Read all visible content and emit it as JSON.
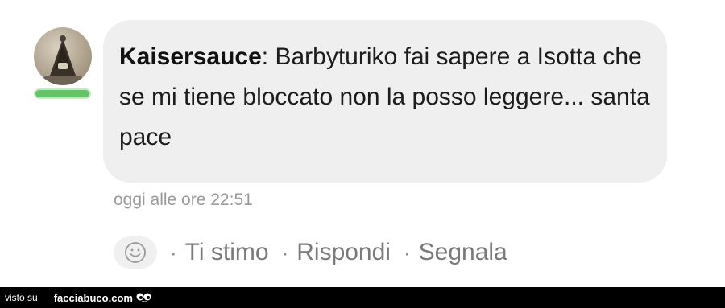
{
  "comment": {
    "author": "Kaisersauce",
    "separator": ":",
    "text": " Barbyturiko fai sapere a Isotta che se mi tiene bloccato non la posso leggere... santa pace",
    "timestamp": "oggi alle ore 22:51",
    "avatar_icon": "avatar-photo-icon",
    "online_status_color": "#66c266"
  },
  "actions": {
    "reaction_icon": "smiley-icon",
    "separator": "·",
    "like_label": "Ti stimo",
    "reply_label": "Rispondi",
    "report_label": "Segnala"
  },
  "footer": {
    "prefix": "visto su",
    "brand": "facciabuco.com",
    "logo_icon": "eyes-icon"
  },
  "colors": {
    "bubble_background": "#efefef",
    "footer_background": "#000000",
    "muted_text": "#7a7a7a"
  }
}
